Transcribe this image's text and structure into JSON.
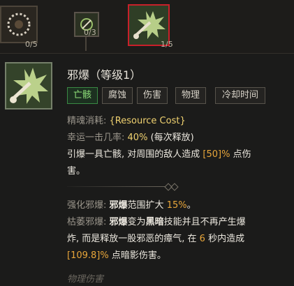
{
  "skill_bar": [
    {
      "name": "skill-slot-1",
      "count": "0/5"
    },
    {
      "name": "skill-slot-2",
      "count": "0/3"
    },
    {
      "name": "skill-slot-3",
      "count": "1/5",
      "selected": true
    }
  ],
  "skill": {
    "title": "邪爆（等级1）",
    "tags": [
      "亡骸",
      "腐蚀",
      "伤害",
      "物理",
      "冷却时间"
    ],
    "cost_label": "精魂消耗:",
    "cost_value": "{Resource Cost}",
    "luck_label": "幸运一击几率:",
    "luck_value": "40%",
    "luck_note": "(每次释放)",
    "desc_a": "引爆一具亡骸, 对周围的敌人造成",
    "desc_value": "[50]%",
    "desc_b": "点伤",
    "desc_c": "害。",
    "enh_label": "强化邪爆:",
    "enh_key": "邪爆",
    "enh_text": "范围扩大",
    "enh_value": "15%",
    "enh_end": "。",
    "blight_label": "枯萎邪爆:",
    "blight_key": "邪爆",
    "blight_t1": "变为",
    "blight_dark": "黑暗",
    "blight_t2": "技能并且不再产生爆",
    "blight_l2a": "炸, 而是释放一股邪恶的瘴气, 在",
    "blight_sec": "6",
    "blight_l2b": "秒内造成",
    "blight_dmg": "[109.8]%",
    "blight_l3": "点暗影伤害。",
    "footer": "物理伤害"
  },
  "colors": {
    "accent_red": "#c8202a",
    "tag_green": "#8fe07a",
    "value_orange": "#e8a63a",
    "value_yellow": "#f0d270"
  }
}
